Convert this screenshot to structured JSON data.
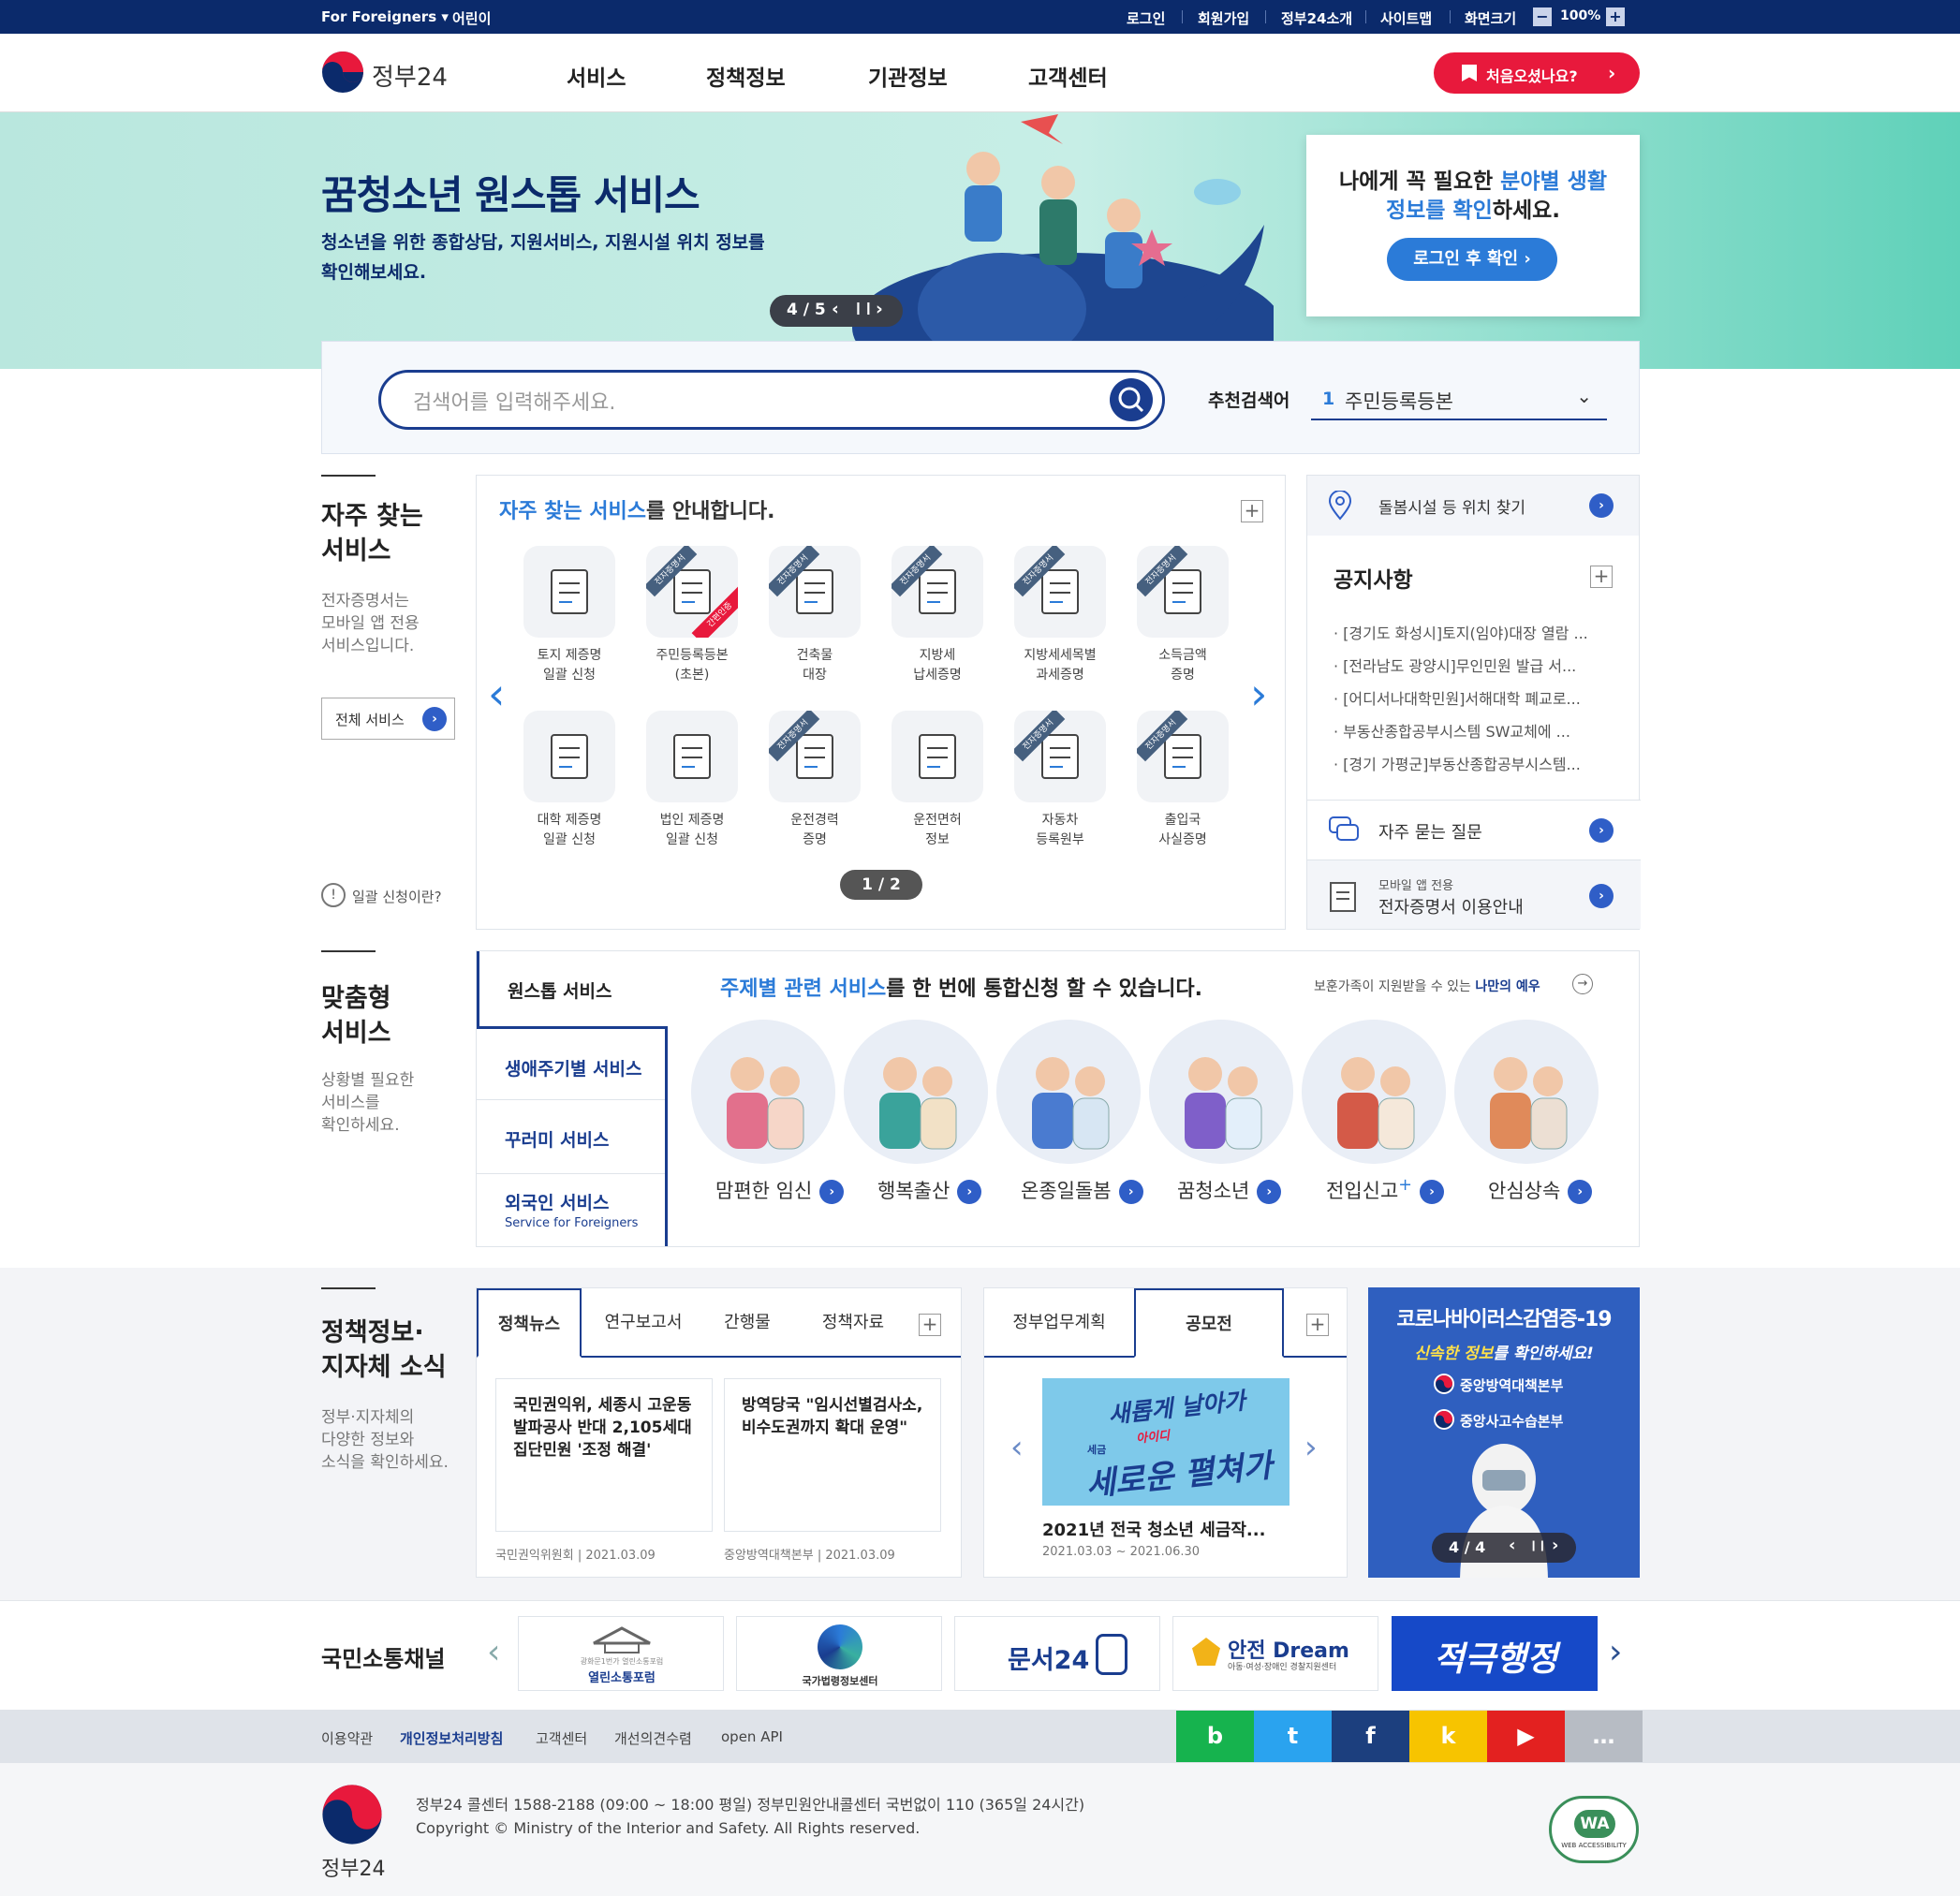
{
  "util": {
    "foreigners": "For Foreigners ▾",
    "kids": "어린이",
    "login": "로그인",
    "join": "회원가입",
    "about": "정부24소개",
    "sitemap": "사이트맵",
    "zoom_label": "화면크기",
    "zoom_minus": "−",
    "zoom_value": "100%",
    "zoom_plus": "+"
  },
  "header": {
    "logo": "정부24",
    "nav": [
      "서비스",
      "정책정보",
      "기관정보",
      "고객센터"
    ],
    "first_visit": "처음오셨나요?"
  },
  "hero": {
    "title": "꿈청소년 원스톱 서비스",
    "desc1": "청소년을 위한 종합상담, 지원서비스, 지원시설 위치 정보를",
    "desc2": "확인해보세요.",
    "pager": "4 / 5",
    "promo_line1_a": "나에게 꼭 필요한 ",
    "promo_line1_b": "분야별 생활",
    "promo_line2_a": "정보를 확인",
    "promo_line2_b": "하세요.",
    "promo_btn": "로그인 후 확인 ›"
  },
  "search": {
    "placeholder": "검색어를 입력해주세요.",
    "rec_label": "추천검색어",
    "rec_num": "1",
    "rec_value": "주민등록등본"
  },
  "frequent": {
    "title1": "자주 찾는",
    "title2": "서비스",
    "desc": "전자증명서는\n모바일 앱 전용\n서비스입니다.",
    "all_btn": "전체 서비스",
    "bulk": "일괄 신청이란?",
    "heading_a": "자주 찾는 서비스",
    "heading_b": "를 안내합니다.",
    "pager": "1 / 2",
    "ribbon": "전자증명서",
    "ribbon2": "간편인증",
    "items": [
      "토지 제증명\n일괄 신청",
      "주민등록등본\n(초본)",
      "건축물\n대장",
      "지방세\n납세증명",
      "지방세세목별\n과세증명",
      "소득금액\n증명",
      "대학 제증명\n일괄 신청",
      "법인 제증명\n일괄 신청",
      "운전경력\n증명",
      "운전면허\n정보",
      "자동차\n등록원부",
      "출입국\n사실증명"
    ]
  },
  "side": {
    "care": "돌봄시설 등 위치 찾기",
    "notice_title": "공지사항",
    "notices": [
      "[경기도 화성시]토지(임야)대장 열람 ...",
      "[전라남도 광양시]무인민원 발급 서...",
      "[어디서나대학민원]서해대학 폐교로...",
      "부동산종합공부시스템 SW교체에 ...",
      "[경기 가평군]부동산종합공부시스템..."
    ],
    "faq": "자주 묻는 질문",
    "mobile_small": "모바일 앱 전용",
    "mobile": "전자증명서 이용안내"
  },
  "custom": {
    "title1": "맞춤형",
    "title2": "서비스",
    "desc": "상황별 필요한\n서비스를\n확인하세요.",
    "tabs": [
      "원스톱 서비스",
      "생애주기별 서비스",
      "꾸러미 서비스",
      "외국인 서비스"
    ],
    "foreign_sub": "Service for Foreigners",
    "heading_a": "주제별 관련 서비스",
    "heading_b": "를 한 번에 통합신청 할 수 있습니다.",
    "note_a": "보훈가족이 지원받을 수 있는 ",
    "note_b": "나만의 예우",
    "circles": [
      "맘편한 임신",
      "행복출산",
      "온종일돌봄",
      "꿈청소년",
      "전입신고",
      "안심상속"
    ],
    "plus_mark": "+"
  },
  "policy": {
    "title1": "정책정보·",
    "title2": "지자체 소식",
    "desc": "정부·지자체의\n다양한 정보와\n소식을 확인하세요.",
    "tabs": [
      "정책뉴스",
      "연구보고서",
      "간행물",
      "정책자료"
    ],
    "news": [
      {
        "text": "국민권익위, 세종시 고운동 발파공사 반대 2,105세대 집단민원 '조정 해결'",
        "org": "국민권익위원회",
        "date": "2021.03.09"
      },
      {
        "text": "방역당국 \"임시선별검사소, 비수도권까지 확대 운영\"",
        "org": "중앙방역대책본부",
        "date": "2021.03.09"
      }
    ],
    "tabs2": [
      "정부업무계획",
      "공모전"
    ],
    "contest_title": "2021년 전국 청소년 세금작...",
    "contest_date": "2021.03.03 ~ 2021.06.30",
    "contest_art1": "새롭게 날아가",
    "contest_art2": "세로운 펼쳐가",
    "contest_art_small": "세금",
    "contest_art_mini": "아이디"
  },
  "covid": {
    "title": "코로나바이러스감염증-19",
    "sub_a": "신속한 정보",
    "sub_b": "를 확인하세요!",
    "link1": "중앙방역대책본부",
    "link2": "중앙사고수습본부",
    "pager": "4 / 4"
  },
  "channel": {
    "title": "국민소통채널",
    "items": [
      "열린소통포럼",
      "국가법령정보센터",
      "문서24",
      "안전 Dream",
      "적극행정"
    ],
    "sub1": "광화문1번가 열린소통포럼",
    "sub4": "아동·여성·장애인 경찰지원센터"
  },
  "footer": {
    "links": [
      "이용약관",
      "개인정보처리방침",
      "고객센터",
      "개선의견수렴",
      "open API"
    ],
    "sns": [
      "b",
      "t",
      "f",
      "k",
      "▶",
      "…"
    ],
    "info": "정부24 콜센터 1588-2188 (09:00 ~ 18:00 평일) 정부민원안내콜센터 국번없이 110 (365일 24시간)",
    "copy": "Copyright © Ministry of the Interior and Safety. All Rights reserved.",
    "logo": "정부24",
    "wa": "WA",
    "wa_text": "WEB ACCESSIBILITY"
  },
  "colors": {
    "navy": "#0b2a6b",
    "accent": "#2b7bd8",
    "red": "#e8193c",
    "mint": "#c5ece4"
  }
}
